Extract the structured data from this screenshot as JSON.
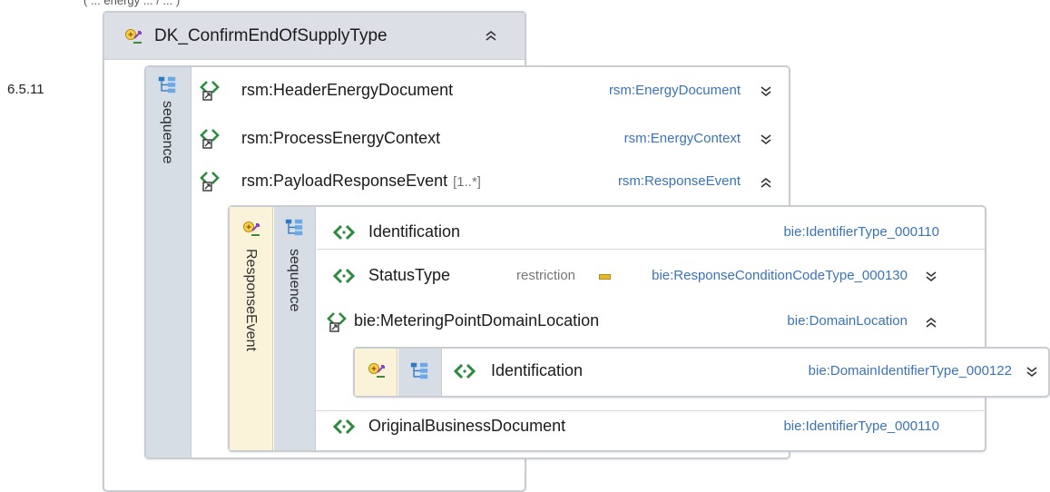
{
  "top_caption": "( ... energy ... / ... )",
  "section_number": "6.5.11",
  "root": {
    "title": "DK_ConfirmEndOfSupplyType"
  },
  "outer_sequence_label": "sequence",
  "outer_elements": [
    {
      "name": "rsm:HeaderEnergyDocument",
      "type": "rsm:EnergyDocument",
      "expanded": false
    },
    {
      "name": "rsm:ProcessEnergyContext",
      "type": "rsm:EnergyContext",
      "expanded": false
    },
    {
      "name": "rsm:PayloadResponseEvent",
      "cardinality": "[1..*]",
      "type": "rsm:ResponseEvent",
      "expanded": true
    }
  ],
  "response_event": {
    "type_label": "ResponseEvent",
    "sequence_label": "sequence",
    "elements": [
      {
        "name": "Identification",
        "type": "bie:IdentifierType_000110"
      },
      {
        "name": "StatusType",
        "restriction": "restriction",
        "type": "bie:ResponseConditionCodeType_000130",
        "expanded": false
      },
      {
        "name": "bie:MeteringPointDomainLocation",
        "type": "bie:DomainLocation",
        "expanded": true
      },
      {
        "name": "OriginalBusinessDocument",
        "type": "bie:IdentifierType_000110"
      }
    ]
  },
  "domain_location": {
    "elements": [
      {
        "name": "Identification",
        "type": "bie:DomainIdentifierType_000122",
        "expanded": false
      }
    ]
  },
  "colors": {
    "type_link": "#3b73b9",
    "strip_blue": "#d7dde5",
    "strip_tan": "#fbf3d9",
    "header_bg": "#dcdfe6",
    "border": "#c9cdd2"
  }
}
